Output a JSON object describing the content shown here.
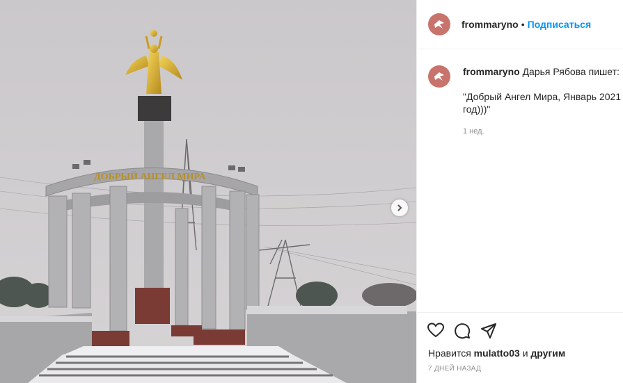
{
  "header": {
    "username": "frommaryno",
    "separator": "•",
    "follow_label": "Подписаться"
  },
  "caption": {
    "username": "frommaryno",
    "text": "Дарья Рябова пишет:",
    "quote": "\"Добрый Ангел Мира, Январь 2021 год)))\"",
    "time_ago": "1 нед."
  },
  "photo": {
    "monument_text": "ДОБРЫЙ АНГЕЛ МИРА"
  },
  "likes": {
    "prefix": "Нравится",
    "user": "mulatto03",
    "middle": "и",
    "others": "другим"
  },
  "date_label": "7 дней назад",
  "colors": {
    "link": "#0095f6",
    "avatar": "#c8736b",
    "muted": "#8e8e8e"
  },
  "icons": [
    "heart-icon",
    "comment-icon",
    "share-icon",
    "chevron-right-icon",
    "avatar-logo-icon"
  ]
}
